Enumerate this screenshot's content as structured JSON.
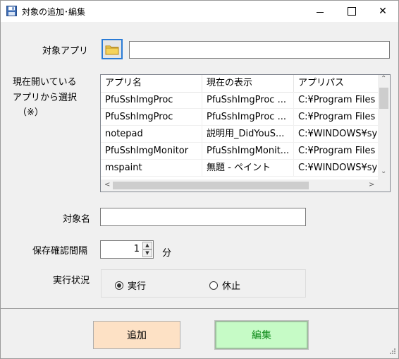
{
  "window": {
    "title": "対象の追加･編集"
  },
  "title_buttons": {
    "minimize": "─",
    "close": "✕"
  },
  "target_app": {
    "label": "対象アプリ",
    "value": ""
  },
  "running_apps": {
    "label_line1": "現在開いている",
    "label_line2": "アプリから選択",
    "label_line3": "（※）",
    "columns": [
      "アプリ名",
      "現在の表示",
      "アプリパス"
    ],
    "rows": [
      [
        "PfuSshImgProc",
        "PfuSshImgProc ...",
        "C:¥Program Files"
      ],
      [
        "PfuSshImgProc",
        "PfuSshImgProc ...",
        "C:¥Program Files"
      ],
      [
        "notepad",
        "説明用_DidYouS...",
        "C:¥WINDOWS¥sy"
      ],
      [
        "PfuSshImgMonitor",
        "PfuSshImgMonit...",
        "C:¥Program Files"
      ],
      [
        "mspaint",
        "無題 - ペイント",
        "C:¥WINDOWS¥sy"
      ]
    ],
    "scroll": {
      "up": "⌃",
      "down": "⌄",
      "left": "<",
      "right": ">"
    }
  },
  "target_name": {
    "label": "対象名",
    "value": ""
  },
  "save_interval": {
    "label": "保存確認間隔",
    "value": "1",
    "unit": "分",
    "up": "▲",
    "down": "▼"
  },
  "exec_status": {
    "label": "実行状況",
    "options": [
      {
        "label": "実行",
        "selected": true
      },
      {
        "label": "休止",
        "selected": false
      }
    ]
  },
  "buttons": {
    "add": "追加",
    "edit": "編集"
  },
  "colors": {
    "add_bg": "#fde1c5",
    "edit_bg": "#c6fbc6",
    "edit_text": "#0f8a1a",
    "focus_border": "#2a7bd6"
  }
}
